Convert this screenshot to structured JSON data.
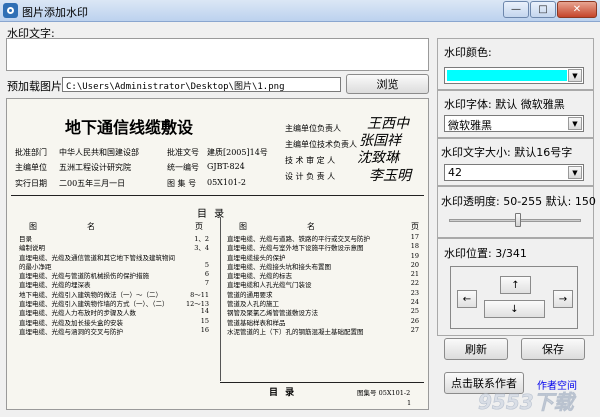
{
  "window": {
    "title": "图片添加水印",
    "minimize": "—",
    "maximize": "□",
    "close": "✕"
  },
  "text_label": "水印文字:",
  "image_label": "预加载图片:",
  "image_path": "C:\\Users\\Administrator\\Desktop\\图片\\1.png",
  "browse_label": "浏览",
  "color_label": "水印颜色:",
  "color_value": "#00ffff",
  "font_label": "水印字体: 默认 微软雅黑",
  "font_value": "微软雅黑",
  "size_label": "水印文字大小: 默认16号字",
  "size_value": "42",
  "opacity_label": "水印透明度: 50-255 默认: 150",
  "opacity_fraction": 0.52,
  "position_label": "水印位置: 3/341",
  "refresh_label": "刷新",
  "save_label": "保存",
  "contact_label": "点击联系作者",
  "author_label": "作者空间",
  "watermark_logo": "9553下载",
  "preview": {
    "title": "地下通信线缆敷设",
    "left_info": [
      {
        "k": "批准部门",
        "v": "中华人民共和国建设部"
      },
      {
        "k": "主编单位",
        "v": "五洲工程设计研究院"
      },
      {
        "k": "实行日期",
        "v": "二00五年三月一日"
      }
    ],
    "mid_info": [
      {
        "k": "批准文号",
        "v": "建质[2005]14号"
      },
      {
        "k": "统一编号",
        "v": "GJBT-824"
      },
      {
        "k": "图 集 号",
        "v": "05X101-2"
      }
    ],
    "right_info": [
      "主编单位负责人",
      "主编单位技术负责人",
      "技 术 审 定 人",
      "设 计 负 责 人"
    ],
    "signatures": [
      "王西中",
      "张国祥",
      "沈致琳",
      "李玉明"
    ],
    "toc_heading": "目   录",
    "toc_col1_heads": [
      "图",
      "名",
      "页"
    ],
    "toc_left": [
      [
        "目录",
        "1、2"
      ],
      [
        "编制说明",
        "3、4"
      ],
      [
        "直埋电缆、光缆及通信管道和其它地下管线及建筑物间",
        ""
      ],
      [
        "的最小净距",
        "5"
      ],
      [
        "直埋电缆、光缆与管道防机械损伤的保护措施",
        "6"
      ],
      [
        "直埋电缆、光缆的埋深表",
        "7"
      ],
      [
        "地下电缆、光缆引入建筑物的做法（一）～（二）",
        "8～11"
      ],
      [
        "直埋电缆、光缆引入建筑物作墙的方式（一）、（二）",
        "12～13"
      ],
      [
        "直埋电缆、光缆人力布放时的步骤及人数",
        "14"
      ],
      [
        "直埋电缆、光缆及加长接头盒的安装",
        "15"
      ],
      [
        "直埋电缆、光缆与涵洞的交叉与防护",
        "16"
      ]
    ],
    "toc_right": [
      [
        "直埋电缆、光缆与道路、铁路的平行或交叉与防护",
        "17"
      ],
      [
        "直埋电缆、光缆与室外地下设施平行敷设示意图",
        "18"
      ],
      [
        "直埋电缆接头的保护",
        "19"
      ],
      [
        "直埋电缆、光缆接头坑和接头布置图",
        "20"
      ],
      [
        "直埋电缆、光缆的标志",
        "21"
      ],
      [
        "直埋电缆和人孔光缆气门装设",
        "22"
      ],
      [
        "管道的通用要求",
        "23"
      ],
      [
        "管道及人孔的施工",
        "24"
      ],
      [
        "钢管及聚氯乙烯管管道敷设方法",
        "25"
      ],
      [
        "管道基础样表和样品",
        "26"
      ],
      [
        "水泥管道的上（下）孔的钢筋混凝土基础配置图",
        "27"
      ]
    ],
    "footer_title": "目   录",
    "footer_code": "图集号 05X101-2",
    "footer_page": "1"
  }
}
